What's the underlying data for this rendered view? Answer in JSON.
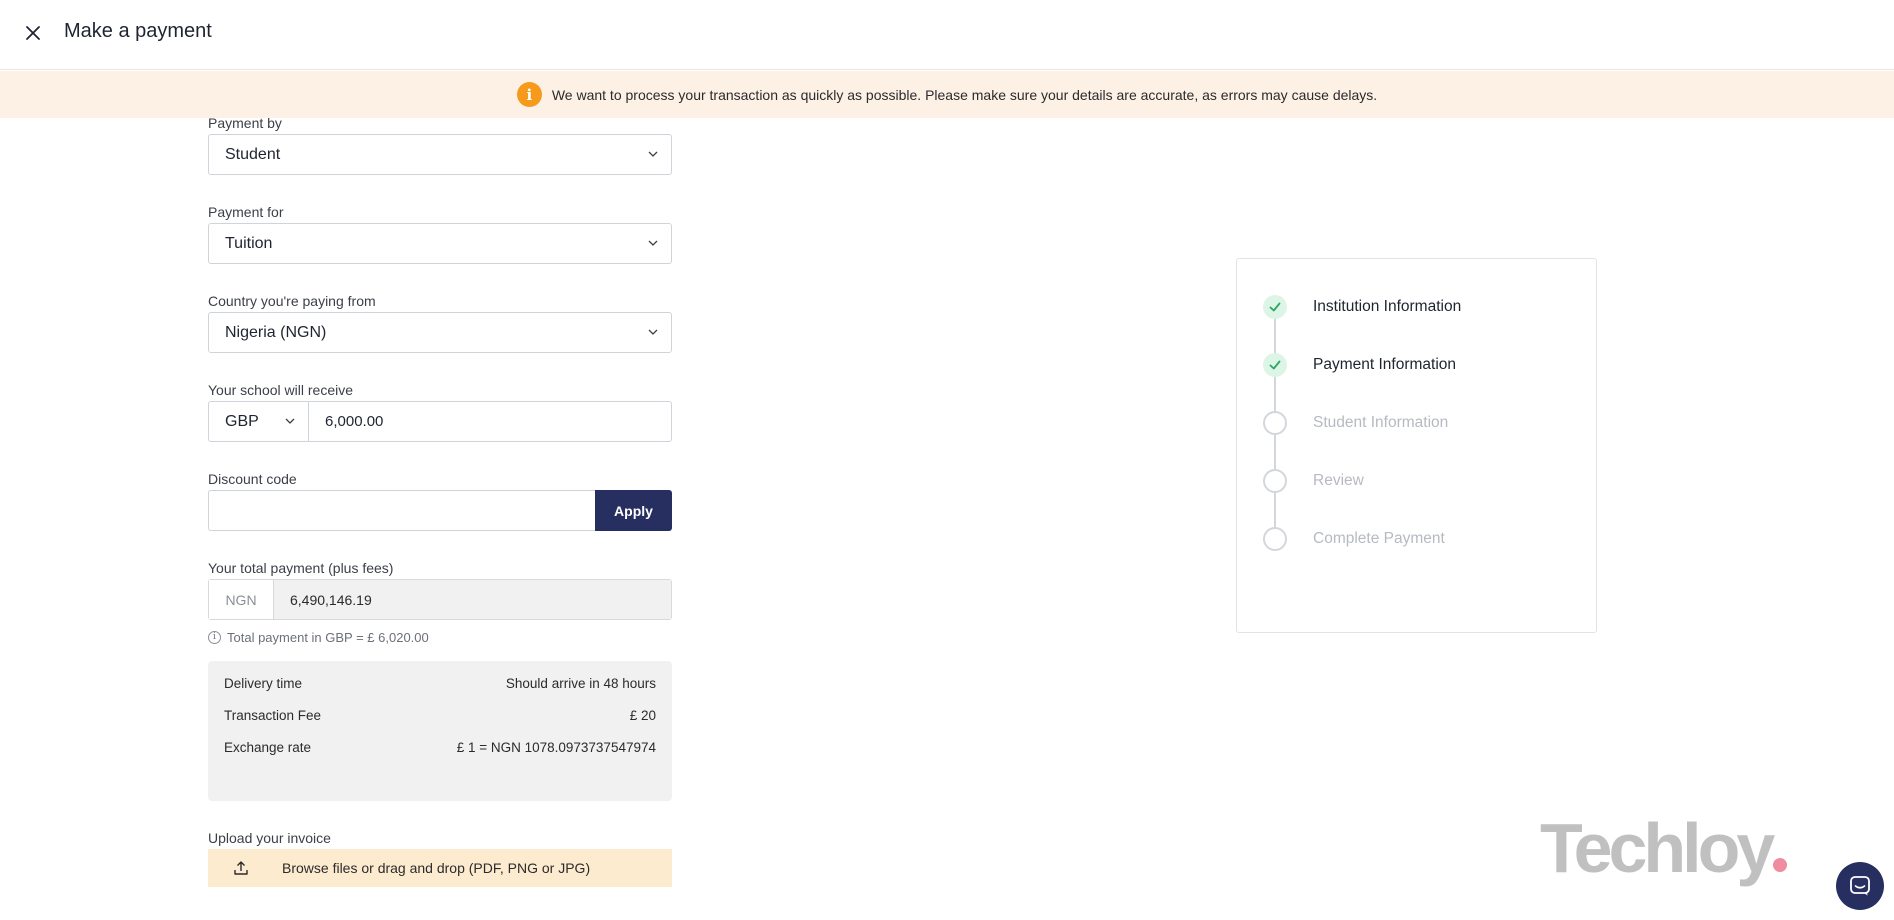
{
  "header": {
    "title": "Make a payment",
    "close_icon": "close-icon"
  },
  "banner": {
    "icon": "info-icon",
    "icon_glyph": "i",
    "text": "We want to process your transaction as quickly as possible. Please make sure your details are accurate, as errors may cause delays."
  },
  "form": {
    "payment_by": {
      "label": "Payment by",
      "value": "Student"
    },
    "payment_for": {
      "label": "Payment for",
      "value": "Tuition"
    },
    "country": {
      "label": "Country you're paying from",
      "value": "Nigeria (NGN)"
    },
    "receive": {
      "label": "Your school will receive",
      "currency": "GBP",
      "amount": "6,000.00"
    },
    "discount": {
      "label": "Discount code",
      "value": "",
      "apply_label": "Apply"
    },
    "total": {
      "label": "Your total payment (plus fees)",
      "currency": "NGN",
      "amount": "6,490,146.19"
    },
    "total_note": {
      "icon_glyph": "i",
      "text": "Total payment in GBP = £ 6,020.00"
    },
    "summary": [
      {
        "label": "Delivery time",
        "value": "Should arrive in 48 hours"
      },
      {
        "label": "Transaction Fee",
        "value": "£ 20"
      },
      {
        "label": "Exchange rate",
        "value": "£ 1 = NGN 1078.0973737547974"
      }
    ],
    "upload": {
      "label": "Upload your invoice",
      "text": "Browse files or drag and drop (PDF, PNG or JPG)",
      "icon": "upload-icon"
    }
  },
  "steps": [
    {
      "label": "Institution Information",
      "status": "done"
    },
    {
      "label": "Payment Information",
      "status": "done"
    },
    {
      "label": "Student Information",
      "status": "todo"
    },
    {
      "label": "Review",
      "status": "todo"
    },
    {
      "label": "Complete Payment",
      "status": "todo"
    }
  ],
  "watermark": {
    "text": "Techloy"
  },
  "chat": {
    "icon": "chat-icon"
  },
  "colors": {
    "primary": "#262f5f",
    "banner_bg": "#fdf1e6",
    "warning": "#f59a1b",
    "success_bg": "#ddf5e7",
    "success": "#2fa661",
    "upload_bg": "#fdebd0"
  }
}
